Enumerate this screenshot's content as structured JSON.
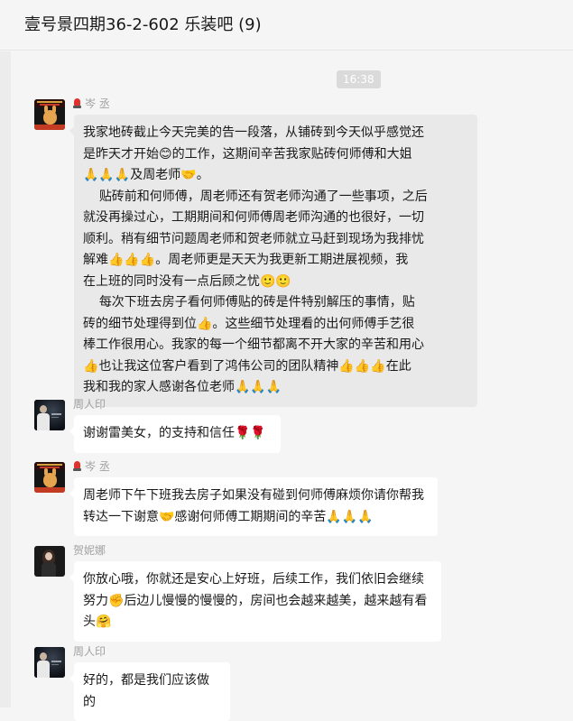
{
  "header": {
    "title": "壹号景四期36-2-602 乐装吧 (9)"
  },
  "divider_time": "16:38",
  "icons": {
    "pray": "🙏",
    "thumbs_up": "👍",
    "blush": "😊",
    "slight_smile": "🙂",
    "handshake": "🤝",
    "rose": "🌹",
    "hand": "✊",
    "hug": "🤗"
  },
  "messages": [
    {
      "sender": "岑 丞",
      "bubble_lines": [
        "我家地砖截止今天完美的告一段落，从铺砖到今天似乎感觉还",
        "是昨天才开始😊的工作，这期间辛苦我家贴砖何师傅和大姐",
        "🙏🙏🙏及周老师🤝。",
        "    贴砖前和何师傅，周老师还有贺老师沟通了一些事项，之后",
        "就没再操过心，工期期间和何师傅周老师沟通的也很好，一切",
        "顺利。稍有细节问题周老师和贺老师就立马赶到现场为我排忧",
        "解难👍👍👍。周老师更是天天为我更新工期进展视频，我",
        "在上班的同时没有一点后顾之忧🙂🙂",
        "    每次下班去房子看何师傅贴的砖是件特别解压的事情，贴",
        "砖的细节处理得到位👍。这些细节处理看的出何师傅手艺很",
        "棒工作很用心。我家的每一个细节都离不开大家的辛苦和用心",
        "👍也让我这位客户看到了鸿伟公司的团队精神👍👍👍在此",
        "我和我的家人感谢各位老师🙏🙏🙏"
      ]
    },
    {
      "sender": "周人印",
      "bubble_lines": [
        "谢谢雷美女，的支持和信任🌹🌹"
      ]
    },
    {
      "sender": "岑 丞",
      "bubble_lines": [
        "周老师下午下班我去房子如果没有碰到何师傅麻烦你请你帮我",
        "转达一下谢意🤝感谢何师傅工期期间的辛苦🙏🙏🙏"
      ]
    },
    {
      "sender": "贺妮娜",
      "bubble_lines": [
        "你放心哦，你就还是安心上好班，后续工作，我们依旧会继续",
        "努力✊后边儿慢慢的慢慢的，房间也会越来越美，越来越有看",
        "头🤗"
      ]
    },
    {
      "sender": "周人印",
      "bubble_lines": [
        "好的，都是我们应该做的"
      ]
    }
  ]
}
